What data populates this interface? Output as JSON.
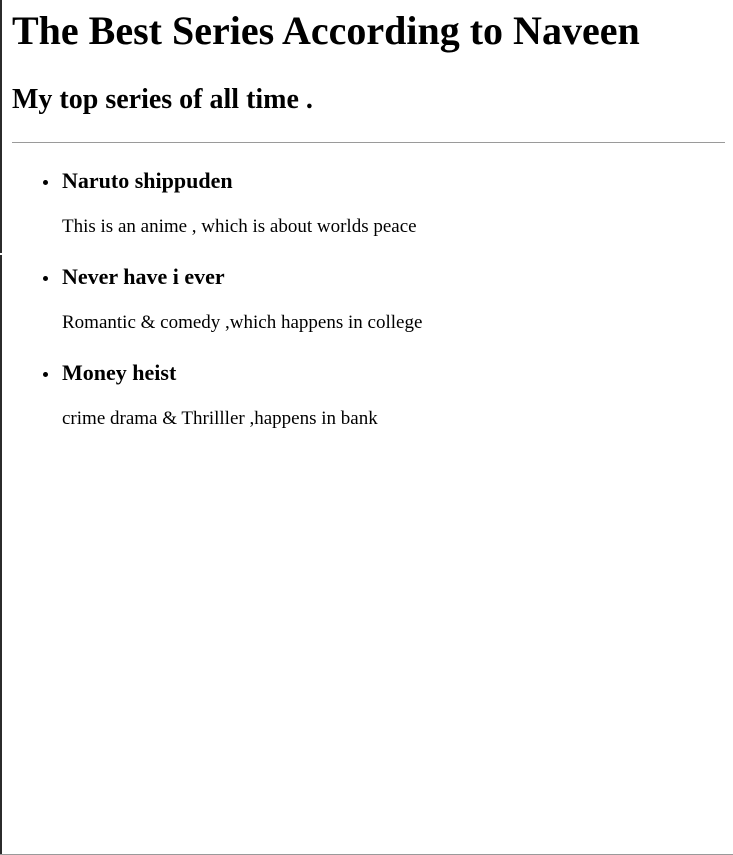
{
  "page": {
    "title": "The Best Series According to Naveen",
    "subtitle": "My top series of all time ."
  },
  "series_list": {
    "items": [
      {
        "title": "Naruto shippuden",
        "description": "This is an anime , which is about worlds peace"
      },
      {
        "title": "Never have i ever",
        "description": "Romantic & comedy ,which happens in college"
      },
      {
        "title": "Money heist",
        "description": "crime drama & Thrilller ,happens in bank"
      }
    ]
  }
}
